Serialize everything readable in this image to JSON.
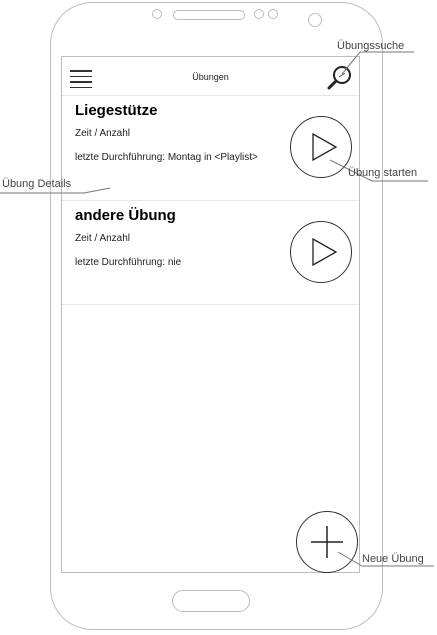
{
  "app": {
    "title": "Übungen"
  },
  "exercises": [
    {
      "name": "Liegestütze",
      "type_label": "Zeit / Anzahl",
      "last_performed": "letzte Durchführung: Montag in <Playlist>"
    },
    {
      "name": "andere Übung",
      "type_label": "Zeit / Anzahl",
      "last_performed": "letzte Durchführung: nie"
    }
  ],
  "annotations": {
    "search": "Übungssuche",
    "start": "Übung starten",
    "details": "Übung Details",
    "new": "Neue Übung"
  },
  "icons": {
    "menu": "hamburger-menu-icon",
    "search": "magnifier-icon",
    "play": "play-triangle-icon",
    "add": "plus-icon"
  }
}
